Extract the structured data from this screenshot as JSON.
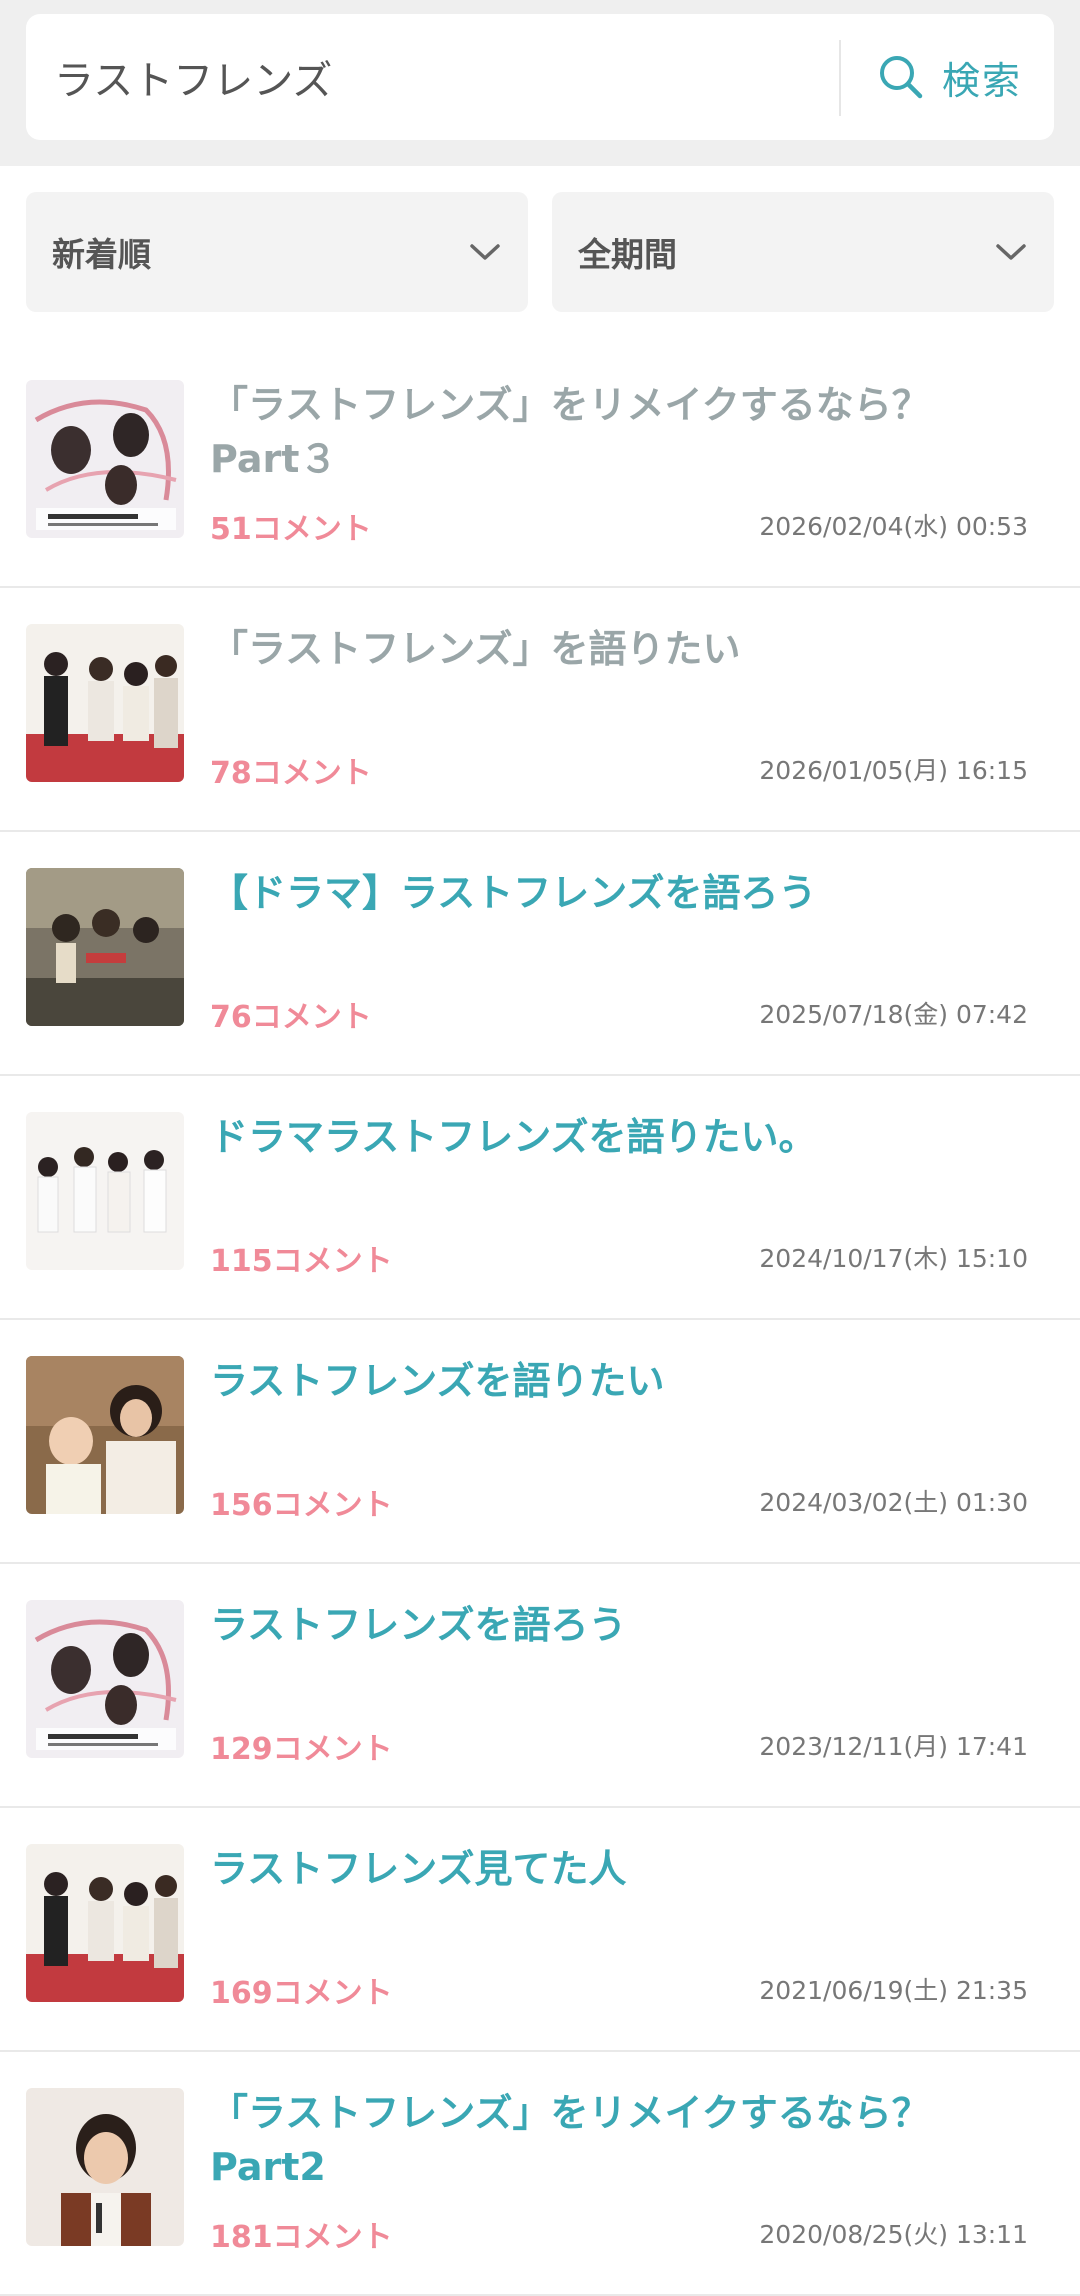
{
  "search": {
    "query": "ラストフレンズ",
    "button_label": "検索",
    "accent_color": "#3aa7b4"
  },
  "filters": {
    "sort": "新着順",
    "period": "全期間"
  },
  "topics": [
    {
      "title": "「ラストフレンズ」をリメイクするなら？Part３",
      "comments": "51コメント",
      "date": "2026/02/04(水) 00:53",
      "visited": true
    },
    {
      "title": "「ラストフレンズ」を語りたい",
      "comments": "78コメント",
      "date": "2026/01/05(月) 16:15",
      "visited": true
    },
    {
      "title": "【ドラマ】ラストフレンズを語ろう",
      "comments": "76コメント",
      "date": "2025/07/18(金) 07:42",
      "visited": false
    },
    {
      "title": "ドラマラストフレンズを語りたい。",
      "comments": "115コメント",
      "date": "2024/10/17(木) 15:10",
      "visited": false
    },
    {
      "title": "ラストフレンズを語りたい",
      "comments": "156コメント",
      "date": "2024/03/02(土) 01:30",
      "visited": false
    },
    {
      "title": "ラストフレンズを語ろう",
      "comments": "129コメント",
      "date": "2023/12/11(月) 17:41",
      "visited": false
    },
    {
      "title": "ラストフレンズ見てた人",
      "comments": "169コメント",
      "date": "2021/06/19(土) 21:35",
      "visited": false
    },
    {
      "title": "「ラストフレンズ」をリメイクするなら？Part2",
      "comments": "181コメント",
      "date": "2020/08/25(火) 13:11",
      "visited": false
    }
  ],
  "colors": {
    "title_link": "#3aa7b4",
    "title_visited": "#9aa6a8",
    "comment_count": "#f08a98"
  }
}
